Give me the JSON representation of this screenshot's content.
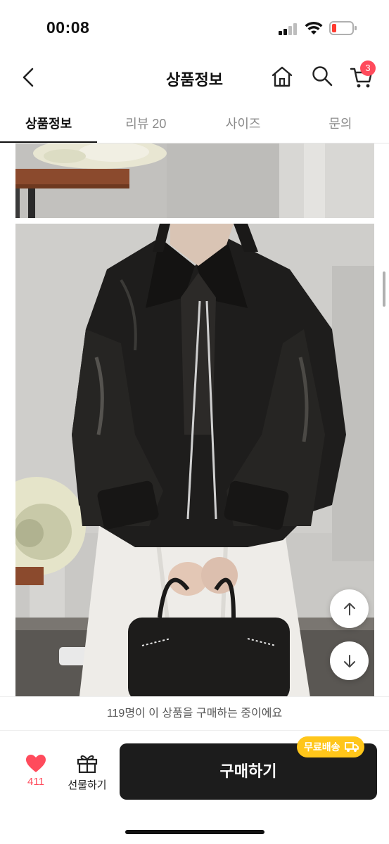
{
  "status_bar": {
    "time": "00:08"
  },
  "header": {
    "title": "상품정보",
    "cart_count": "3"
  },
  "tabs": [
    {
      "label": "상품정보",
      "active": true
    },
    {
      "label": "리뷰 20",
      "active": false
    },
    {
      "label": "사이즈",
      "active": false
    },
    {
      "label": "문의",
      "active": false
    }
  ],
  "icons": {
    "back": "chevron-left-icon",
    "home": "home-icon",
    "search": "search-icon",
    "cart": "cart-icon",
    "scroll_up": "arrow-up-icon",
    "scroll_down": "arrow-down-icon",
    "like": "heart-icon",
    "gift": "gift-icon",
    "truck": "truck-icon"
  },
  "notice": "119명이 이 상품을 구매하는 중이에요",
  "bottom_bar": {
    "like_count": "411",
    "gift_label": "선물하기",
    "buy_label": "구매하기",
    "shipping_badge": "무료배송"
  },
  "colors": {
    "accent": "#ff4b5c",
    "buy_button": "#1c1c1c",
    "shipping_badge": "#ffc61a",
    "tab_inactive": "#8a8a8a"
  }
}
